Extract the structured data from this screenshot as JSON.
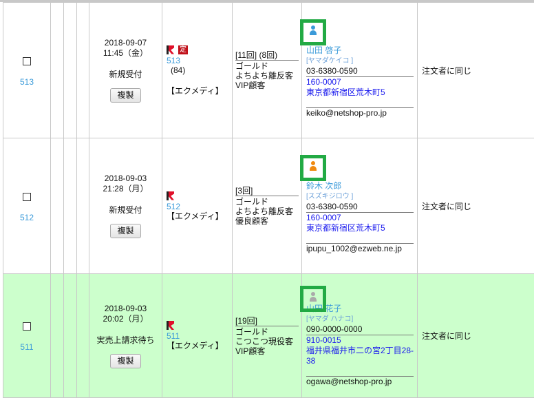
{
  "duplicate_label": "複製",
  "orders": [
    {
      "id": "513",
      "date": "2018-09-07",
      "time": "11:45（金）",
      "status": "新規受付",
      "teiki_badge": "定",
      "source_id": "513",
      "source_count": "(84)",
      "source_name": "【エクメディ】",
      "counts": "[11回] (8回)",
      "rank": "ゴールド",
      "segment": "よちよち離反客",
      "tier": "VIP顧客",
      "name": "山田 啓子",
      "kana": "[ヤマダケイコ ]",
      "tel": "03-6380-0590",
      "zip": "160-0007",
      "address": "東京都新宿区荒木町5",
      "email": "keiko@netshop-pro.jp",
      "shipping": "注文者に同じ",
      "avatar_color": "#3a9ad9"
    },
    {
      "id": "512",
      "date": "2018-09-03",
      "time": "21:28（月）",
      "status": "新規受付",
      "source_id": "512",
      "source_name": "【エクメディ】",
      "counts": "[3回]",
      "rank": "ゴールド",
      "segment": "よちよち離反客",
      "tier": "優良顧客",
      "name": "鈴木 次郎",
      "kana": "[スズキジロウ ]",
      "tel": "03-6380-0590",
      "zip": "160-0007",
      "address": "東京都新宿区荒木町5",
      "email": "ipupu_1002@ezweb.ne.jp",
      "shipping": "注文者に同じ",
      "avatar_color": "#f08a10"
    },
    {
      "id": "511",
      "date": "2018-09-03",
      "time": "20:02（月）",
      "status": "実売上請求待ち",
      "source_id": "511",
      "source_name": "【エクメディ】",
      "counts": "[19回]",
      "rank": "ゴールド",
      "segment": "こつこつ現役客",
      "tier": "VIP顧客",
      "name": "山田 花子",
      "kana": "[ヤマダ ハナコ]",
      "tel": "090-0000-0000",
      "zip": "910-0015",
      "address": "福井県福井市二の宮2丁目28-38",
      "email": "ogawa@netshop-pro.jp",
      "shipping": "注文者に同じ",
      "avatar_color": "#aaaaaa",
      "row_color": "#ccffcc"
    }
  ]
}
